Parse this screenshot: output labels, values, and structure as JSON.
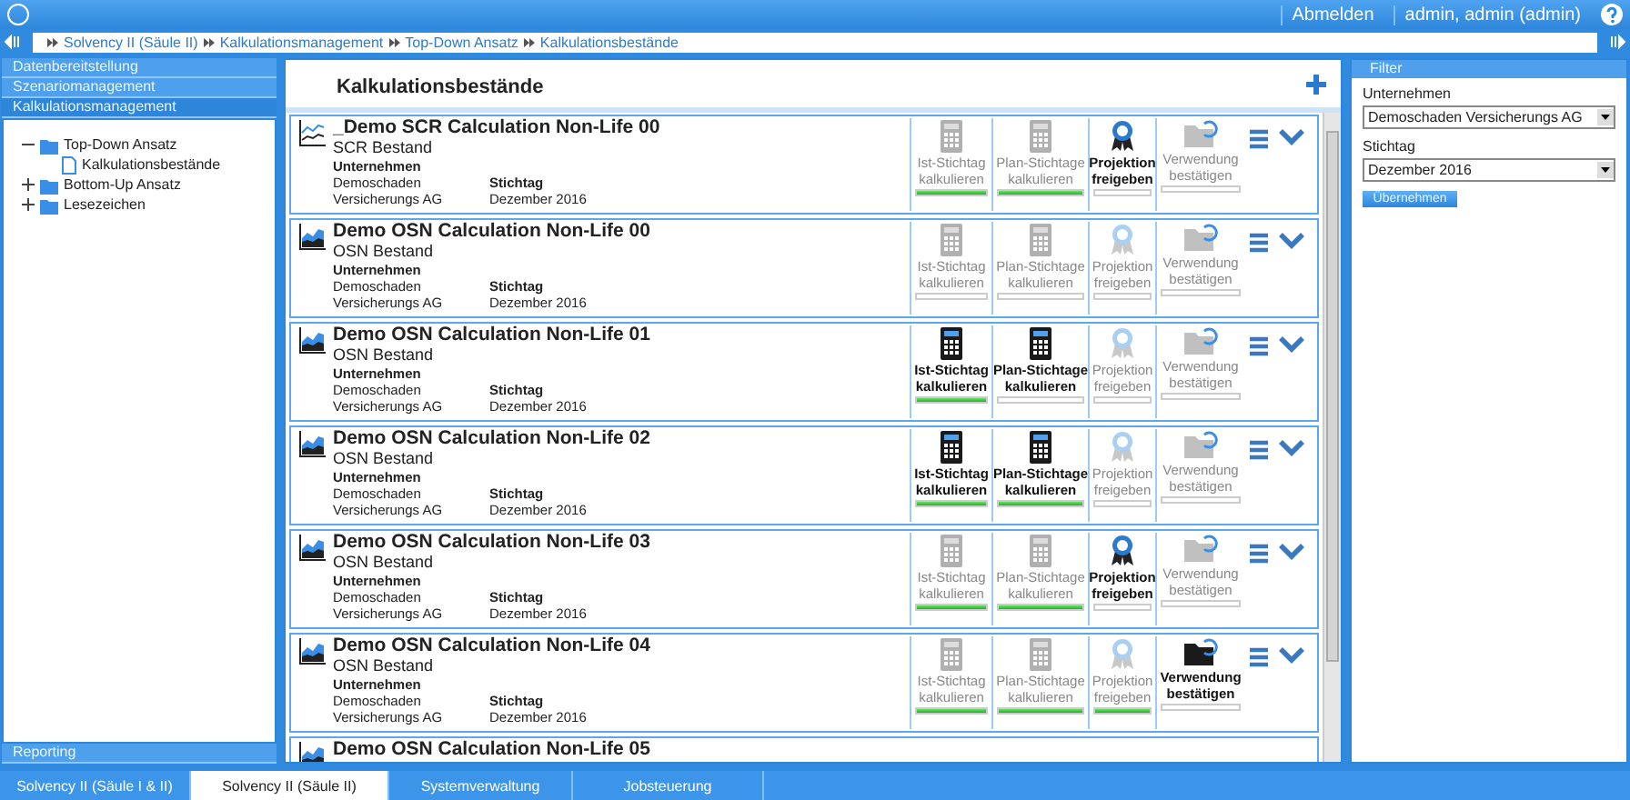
{
  "top_bar": {
    "logout": "Abmelden",
    "user": "admin, admin (admin)"
  },
  "breadcrumb": [
    "Solvency II (Säule II)",
    "Kalkulationsmanagement",
    "Top-Down Ansatz",
    "Kalkulationsbestände"
  ],
  "sidebar": {
    "sections": [
      {
        "label": "Datenbereitstellung",
        "expanded": false
      },
      {
        "label": "Szenariomanagement",
        "expanded": false
      },
      {
        "label": "Kalkulationsmanagement",
        "expanded": true
      }
    ],
    "tree": [
      {
        "label": "Top-Down Ansatz",
        "kind": "folder",
        "expanded": true,
        "children": [
          {
            "label": "Kalkulationsbestände",
            "kind": "page"
          }
        ]
      },
      {
        "label": "Bottom-Up Ansatz",
        "kind": "folder",
        "expanded": false
      },
      {
        "label": "Lesezeichen",
        "kind": "folder",
        "expanded": false
      }
    ],
    "footer_section": "Reporting"
  },
  "main": {
    "title": "Kalkulationsbestände",
    "cards": [
      {
        "title": "_Demo SCR Calculation Non-Life 00",
        "subtitle": "SCR Bestand",
        "kind": "line",
        "company_label": "Unternehmen",
        "date_label": "Stichtag",
        "company": [
          "Demoschaden",
          "Versicherungs AG"
        ],
        "date": "Dezember 2016",
        "actions": [
          {
            "kind": "calculator",
            "label": [
              "Ist-Stichtag",
              "kalkulieren"
            ],
            "active": false,
            "done": true
          },
          {
            "kind": "calculator",
            "label": [
              "Plan-Stichtage",
              "kalkulieren"
            ],
            "active": false,
            "done": true
          },
          {
            "kind": "award",
            "label": [
              "Projektion",
              "freigeben"
            ],
            "active": true,
            "done": false
          },
          {
            "kind": "folder",
            "label": [
              "Verwendung",
              "bestätigen"
            ],
            "active": false,
            "done": false
          }
        ]
      },
      {
        "title": "Demo OSN Calculation Non-Life 00",
        "subtitle": "OSN Bestand",
        "kind": "area",
        "company_label": "Unternehmen",
        "date_label": "Stichtag",
        "company": [
          "Demoschaden",
          "Versicherungs AG"
        ],
        "date": "Dezember 2016",
        "actions": [
          {
            "kind": "calculator",
            "label": [
              "Ist-Stichtag",
              "kalkulieren"
            ],
            "active": false,
            "done": false
          },
          {
            "kind": "calculator",
            "label": [
              "Plan-Stichtage",
              "kalkulieren"
            ],
            "active": false,
            "done": false
          },
          {
            "kind": "award",
            "label": [
              "Projektion",
              "freigeben"
            ],
            "active": false,
            "done": false
          },
          {
            "kind": "folder",
            "label": [
              "Verwendung",
              "bestätigen"
            ],
            "active": false,
            "done": false
          }
        ]
      },
      {
        "title": "Demo OSN Calculation Non-Life 01",
        "subtitle": "OSN Bestand",
        "kind": "area",
        "company_label": "Unternehmen",
        "date_label": "Stichtag",
        "company": [
          "Demoschaden",
          "Versicherungs AG"
        ],
        "date": "Dezember 2016",
        "actions": [
          {
            "kind": "calculator",
            "label": [
              "Ist-Stichtag",
              "kalkulieren"
            ],
            "active": true,
            "done": true
          },
          {
            "kind": "calculator",
            "label": [
              "Plan-Stichtage",
              "kalkulieren"
            ],
            "active": true,
            "done": false
          },
          {
            "kind": "award",
            "label": [
              "Projektion",
              "freigeben"
            ],
            "active": false,
            "done": false
          },
          {
            "kind": "folder",
            "label": [
              "Verwendung",
              "bestätigen"
            ],
            "active": false,
            "done": false
          }
        ]
      },
      {
        "title": "Demo OSN Calculation Non-Life 02",
        "subtitle": "OSN Bestand",
        "kind": "area",
        "company_label": "Unternehmen",
        "date_label": "Stichtag",
        "company": [
          "Demoschaden",
          "Versicherungs AG"
        ],
        "date": "Dezember 2016",
        "actions": [
          {
            "kind": "calculator",
            "label": [
              "Ist-Stichtag",
              "kalkulieren"
            ],
            "active": true,
            "done": true
          },
          {
            "kind": "calculator",
            "label": [
              "Plan-Stichtage",
              "kalkulieren"
            ],
            "active": true,
            "done": true
          },
          {
            "kind": "award",
            "label": [
              "Projektion",
              "freigeben"
            ],
            "active": false,
            "done": false
          },
          {
            "kind": "folder",
            "label": [
              "Verwendung",
              "bestätigen"
            ],
            "active": false,
            "done": false
          }
        ]
      },
      {
        "title": "Demo OSN Calculation Non-Life 03",
        "subtitle": "OSN Bestand",
        "kind": "area",
        "company_label": "Unternehmen",
        "date_label": "Stichtag",
        "company": [
          "Demoschaden",
          "Versicherungs AG"
        ],
        "date": "Dezember 2016",
        "actions": [
          {
            "kind": "calculator",
            "label": [
              "Ist-Stichtag",
              "kalkulieren"
            ],
            "active": false,
            "done": true
          },
          {
            "kind": "calculator",
            "label": [
              "Plan-Stichtage",
              "kalkulieren"
            ],
            "active": false,
            "done": true
          },
          {
            "kind": "award",
            "label": [
              "Projektion",
              "freigeben"
            ],
            "active": true,
            "done": false
          },
          {
            "kind": "folder",
            "label": [
              "Verwendung",
              "bestätigen"
            ],
            "active": false,
            "done": false
          }
        ]
      },
      {
        "title": "Demo OSN Calculation Non-Life 04",
        "subtitle": "OSN Bestand",
        "kind": "area",
        "company_label": "Unternehmen",
        "date_label": "Stichtag",
        "company": [
          "Demoschaden",
          "Versicherungs AG"
        ],
        "date": "Dezember 2016",
        "actions": [
          {
            "kind": "calculator",
            "label": [
              "Ist-Stichtag",
              "kalkulieren"
            ],
            "active": false,
            "done": true
          },
          {
            "kind": "calculator",
            "label": [
              "Plan-Stichtage",
              "kalkulieren"
            ],
            "active": false,
            "done": true
          },
          {
            "kind": "award",
            "label": [
              "Projektion",
              "freigeben"
            ],
            "active": false,
            "done": true
          },
          {
            "kind": "folder",
            "label": [
              "Verwendung",
              "bestätigen"
            ],
            "active": true,
            "done": false
          }
        ]
      },
      {
        "title": "Demo OSN Calculation Non-Life 05",
        "kind": "area"
      }
    ]
  },
  "filter": {
    "title": "Filter",
    "fields": [
      {
        "label": "Unternehmen",
        "value": "Demoschaden Versicherungs AG"
      },
      {
        "label": "Stichtag",
        "value": "Dezember 2016"
      }
    ],
    "apply": "Übernehmen"
  },
  "bottom_tabs": [
    {
      "label": "Solvency II (Säule I & II)",
      "selected": false
    },
    {
      "label": "Solvency II (Säule II)",
      "selected": true
    },
    {
      "label": "Systemverwaltung",
      "selected": false
    },
    {
      "label": "Jobsteuerung",
      "selected": false
    }
  ]
}
